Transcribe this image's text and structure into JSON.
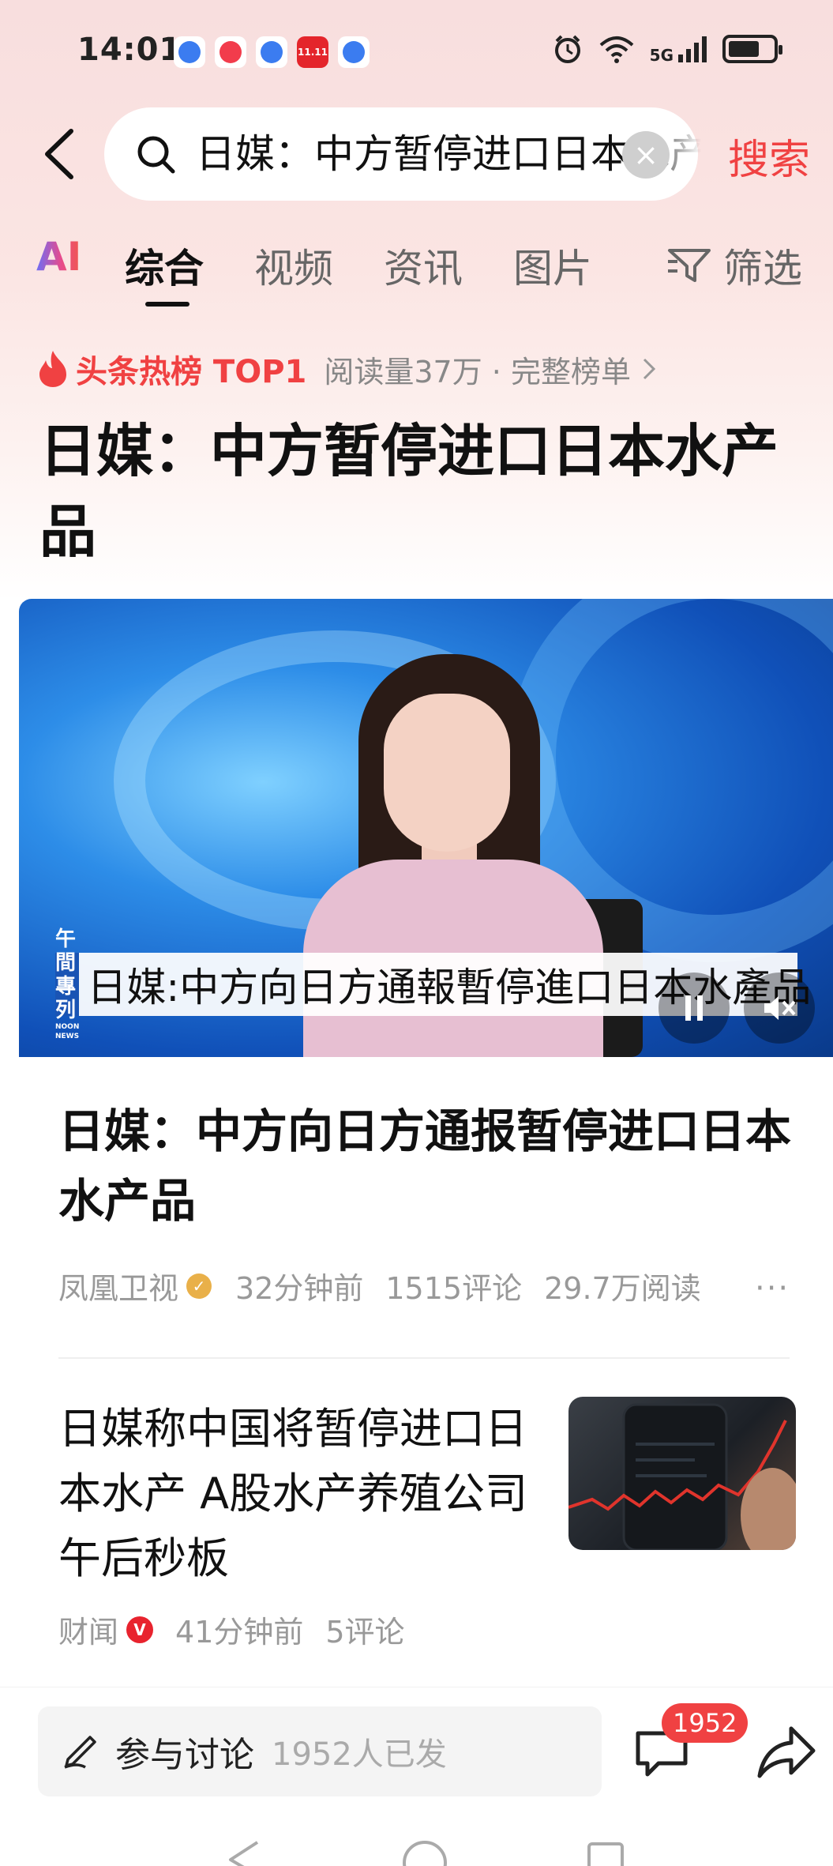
{
  "status_bar": {
    "time": "14:01",
    "network": "5G",
    "notification_icons": [
      "blue-app-icon",
      "red-video-icon",
      "blue-app-icon",
      "jd-shopping-icon",
      "blue-app-icon"
    ],
    "jd_badge": "11.11"
  },
  "search": {
    "query": "日媒：中方暂停进口日本水产品",
    "search_label": "搜索"
  },
  "tabs": {
    "ai": "AI",
    "items": [
      "综合",
      "视频",
      "资讯",
      "图片"
    ],
    "active": "综合",
    "filter": "筛选"
  },
  "hot_rank": {
    "label": "头条热榜 TOP1",
    "meta": "阅读量37万 · 完整榜单"
  },
  "headline": "日媒：中方暂停进口日本水产品",
  "video": {
    "logo_line1": "午間",
    "logo_line2": "專列",
    "logo_caption": "NOON NEWS",
    "lower_third": "日媒:中方向日方通報暫停進口日本水產品"
  },
  "articles": [
    {
      "title": "日媒：中方向日方通报暂停进口日本水产品",
      "source": "凤凰卫视",
      "time": "32分钟前",
      "comments": "1515评论",
      "reads": "29.7万阅读",
      "more": "···"
    },
    {
      "title": "日媒称中国将暂停进口日本水产 A股水产养殖公司午后秒板",
      "source": "财闻",
      "time": "41分钟前",
      "comments": "5评论"
    }
  ],
  "bottom_bar": {
    "discuss_label": "参与讨论",
    "discuss_count": "1952人已发",
    "comment_badge": "1952"
  },
  "colors": {
    "accent_red": "#f04142",
    "verified_gold": "#e9b049",
    "verified_red": "#e8232e"
  }
}
